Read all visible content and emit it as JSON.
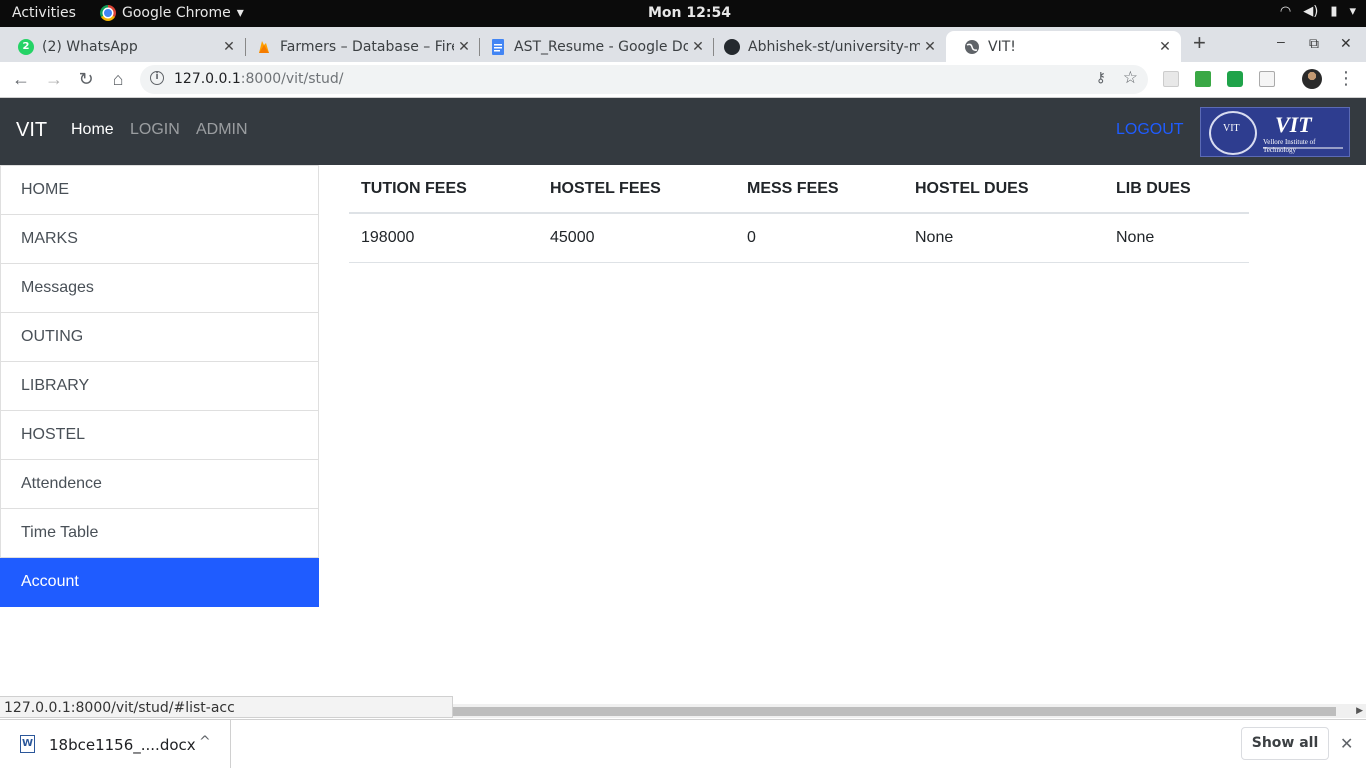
{
  "os": {
    "activities": "Activities",
    "app_menu": "Google Chrome",
    "clock": "Mon 12:54"
  },
  "tabs": [
    {
      "title": "(2) WhatsApp",
      "icon": "whatsapp-icon"
    },
    {
      "title": "Farmers – Database – Fire",
      "icon": "firebase-icon"
    },
    {
      "title": "AST_Resume - Google Do",
      "icon": "google-docs-icon"
    },
    {
      "title": "Abhishek-st/university-m",
      "icon": "github-icon"
    },
    {
      "title": "VIT!",
      "icon": "globe-icon"
    }
  ],
  "address": {
    "host": "127.0.0.1",
    "rest": ":8000/vit/stud/"
  },
  "site": {
    "brand": "VIT",
    "nav": [
      "Home",
      "LOGIN",
      "ADMIN"
    ],
    "logout": "LOGOUT",
    "logo_text": "VIT",
    "logo_sub": "Vellore Institute of Technology"
  },
  "sidebar": [
    "HOME",
    "MARKS",
    "Messages",
    "OUTING",
    "LIBRARY",
    "HOSTEL",
    "Attendence",
    "Time Table",
    "Account"
  ],
  "fees_table": {
    "headers": [
      "TUTION FEES",
      "HOSTEL FEES",
      "MESS FEES",
      "HOSTEL DUES",
      "LIB DUES"
    ],
    "rows": [
      [
        "198000",
        "45000",
        "0",
        "None",
        "None"
      ]
    ]
  },
  "status_url": "127.0.0.1:8000/vit/stud/#list-acc",
  "downloads": {
    "file": "18bce1156_....docx",
    "show_all": "Show all"
  },
  "colors": {
    "navbar": "#343a40",
    "active_item": "#1f5cff",
    "logout_link": "#1f5cff"
  }
}
